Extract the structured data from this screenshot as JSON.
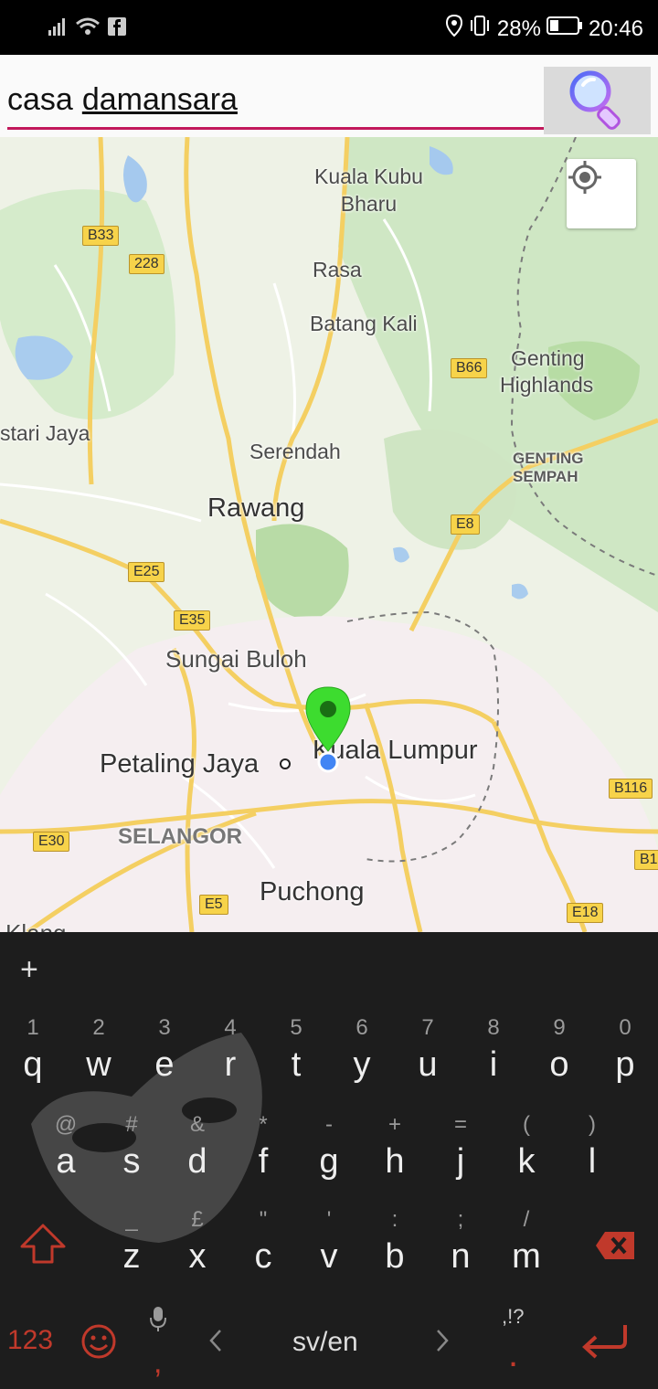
{
  "status_bar": {
    "battery": "28%",
    "time": "20:46"
  },
  "search": {
    "query_word1": "casa",
    "query_word2": "damansara"
  },
  "map": {
    "places": {
      "kuala_kubu_bharu_1": "Kuala Kubu",
      "kuala_kubu_bharu_2": "Bharu",
      "rasa": "Rasa",
      "batang_kali": "Batang Kali",
      "genting_1": "Genting",
      "genting_2": "Highlands",
      "bestari_jaya": "stari Jaya",
      "serendah": "Serendah",
      "genting_sempah_1": "GENTING",
      "genting_sempah_2": "SEMPAH",
      "rawang": "Rawang",
      "sungai_buloh": "Sungai Buloh",
      "petaling_jaya": "Petaling Jaya",
      "kuala_lumpur": "Kuala Lumpur",
      "selangor": "SELANGOR",
      "puchong": "Puchong",
      "klang": "Klang"
    },
    "road_shields": {
      "b33": "B33",
      "r228": "228",
      "b66": "B66",
      "e8": "E8",
      "e25": "E25",
      "e35": "E35",
      "b116": "B116",
      "e30": "E30",
      "b1": "B1",
      "e5": "E5",
      "e18": "E18"
    },
    "marker_color": "#3ddc2f",
    "location_dot_color": "#4285f4"
  },
  "keyboard": {
    "row1": [
      {
        "hint": "1",
        "ch": "q"
      },
      {
        "hint": "2",
        "ch": "w"
      },
      {
        "hint": "3",
        "ch": "e"
      },
      {
        "hint": "4",
        "ch": "r"
      },
      {
        "hint": "5",
        "ch": "t"
      },
      {
        "hint": "6",
        "ch": "y"
      },
      {
        "hint": "7",
        "ch": "u"
      },
      {
        "hint": "8",
        "ch": "i"
      },
      {
        "hint": "9",
        "ch": "o"
      },
      {
        "hint": "0",
        "ch": "p"
      }
    ],
    "row2": [
      {
        "hint": "@",
        "ch": "a"
      },
      {
        "hint": "#",
        "ch": "s"
      },
      {
        "hint": "&",
        "ch": "d"
      },
      {
        "hint": "*",
        "ch": "f"
      },
      {
        "hint": "-",
        "ch": "g"
      },
      {
        "hint": "+",
        "ch": "h"
      },
      {
        "hint": "=",
        "ch": "j"
      },
      {
        "hint": "(",
        "ch": "k"
      },
      {
        "hint": ")",
        "ch": "l"
      }
    ],
    "row3": [
      {
        "hint": "_",
        "ch": "z"
      },
      {
        "hint": "£",
        "ch": "x"
      },
      {
        "hint": "\"",
        "ch": "c"
      },
      {
        "hint": "'",
        "ch": "v"
      },
      {
        "hint": ":",
        "ch": "b"
      },
      {
        "hint": ";",
        "ch": "n"
      },
      {
        "hint": "/",
        "ch": "m"
      }
    ],
    "plus": "+",
    "numbers_label": "123",
    "comma": ",",
    "language": "sv/en",
    "punct_hint": ",!?",
    "period": "."
  }
}
